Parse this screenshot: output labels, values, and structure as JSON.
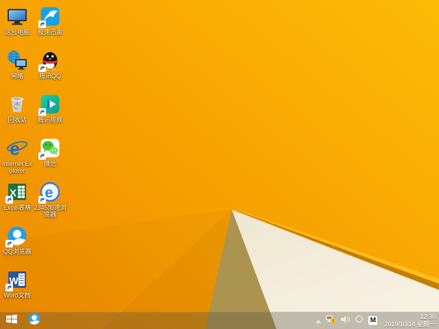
{
  "wallpaper": {
    "cream": "#f3ecda",
    "khaki": "#ab944f",
    "ridge_bright": "#ffc01e",
    "ridge_dark": "#c57e03",
    "base_top_right": "#fdba07",
    "base_bottom_left": "#ec8a00"
  },
  "desktop": {
    "icons": [
      {
        "icon": "this-pc",
        "label": "这台电脑",
        "shortcut": false,
        "col": 0,
        "row": 0
      },
      {
        "icon": "network",
        "label": "网络",
        "shortcut": false,
        "col": 0,
        "row": 1
      },
      {
        "icon": "recycle-bin",
        "label": "回收站",
        "shortcut": false,
        "col": 0,
        "row": 2
      },
      {
        "icon": "internet-explorer",
        "label": "Internet Explorer",
        "shortcut": false,
        "col": 0,
        "row": 3
      },
      {
        "icon": "excel",
        "label": "Excel表格",
        "shortcut": true,
        "col": 0,
        "row": 4
      },
      {
        "icon": "qq-browser",
        "label": "QQ浏览器",
        "shortcut": true,
        "col": 0,
        "row": 5
      },
      {
        "icon": "word",
        "label": "Word文档",
        "shortcut": true,
        "col": 0,
        "row": 6
      },
      {
        "icon": "xunlei",
        "label": "极速迅雷",
        "shortcut": true,
        "col": 1,
        "row": 0
      },
      {
        "icon": "qq",
        "label": "腾讯QQ",
        "shortcut": true,
        "col": 1,
        "row": 1
      },
      {
        "icon": "tencent-video",
        "label": "腾讯视频",
        "shortcut": true,
        "col": 1,
        "row": 2
      },
      {
        "icon": "wechat",
        "label": "微信",
        "shortcut": true,
        "col": 1,
        "row": 3
      },
      {
        "icon": "browser-2345",
        "label": "2345加速浏览器",
        "shortcut": true,
        "col": 1,
        "row": 4
      }
    ]
  },
  "taskbar": {
    "tray": {
      "input_method_label": "M"
    },
    "clock": {
      "time": "12:30",
      "date": "2019/10/14 星期一"
    }
  }
}
